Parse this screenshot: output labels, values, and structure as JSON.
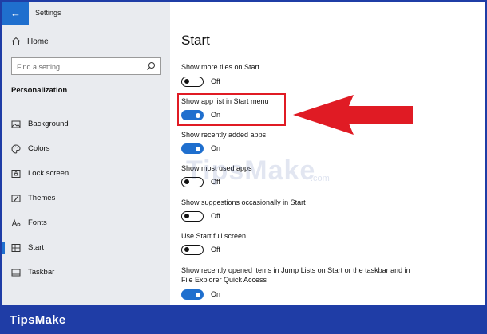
{
  "window": {
    "title": "Settings",
    "back_icon": "arrow-left-icon"
  },
  "sidebar": {
    "home_label": "Home",
    "search_placeholder": "Find a setting",
    "section_title": "Personalization",
    "items": [
      {
        "label": "Background",
        "icon": "image-icon"
      },
      {
        "label": "Colors",
        "icon": "palette-icon"
      },
      {
        "label": "Lock screen",
        "icon": "lock-screen-icon"
      },
      {
        "label": "Themes",
        "icon": "themes-icon"
      },
      {
        "label": "Fonts",
        "icon": "font-icon"
      },
      {
        "label": "Start",
        "icon": "start-icon",
        "active": true
      },
      {
        "label": "Taskbar",
        "icon": "taskbar-icon"
      }
    ]
  },
  "main": {
    "title": "Start",
    "settings": [
      {
        "label": "Show more tiles on Start",
        "state": "Off"
      },
      {
        "label": "Show app list in Start menu",
        "state": "On"
      },
      {
        "label": "Show recently added apps",
        "state": "On"
      },
      {
        "label": "Show most used apps",
        "state": "Off"
      },
      {
        "label": "Show suggestions occasionally in Start",
        "state": "Off"
      },
      {
        "label": "Use Start full screen",
        "state": "Off"
      },
      {
        "label": "Show recently opened items in Jump Lists on Start or the taskbar and in File Explorer Quick Access",
        "state": "On"
      }
    ]
  },
  "annotation": {
    "highlight_color": "#e01b24",
    "arrow_color": "#e01b24"
  },
  "watermark": {
    "text": "TipsMake",
    "suffix": ".com"
  },
  "footer": {
    "brand": "TipsMake",
    "background": "#1f3da6"
  },
  "colors": {
    "accent": "#1f6fce",
    "sidebar_bg": "#e9ebef"
  }
}
